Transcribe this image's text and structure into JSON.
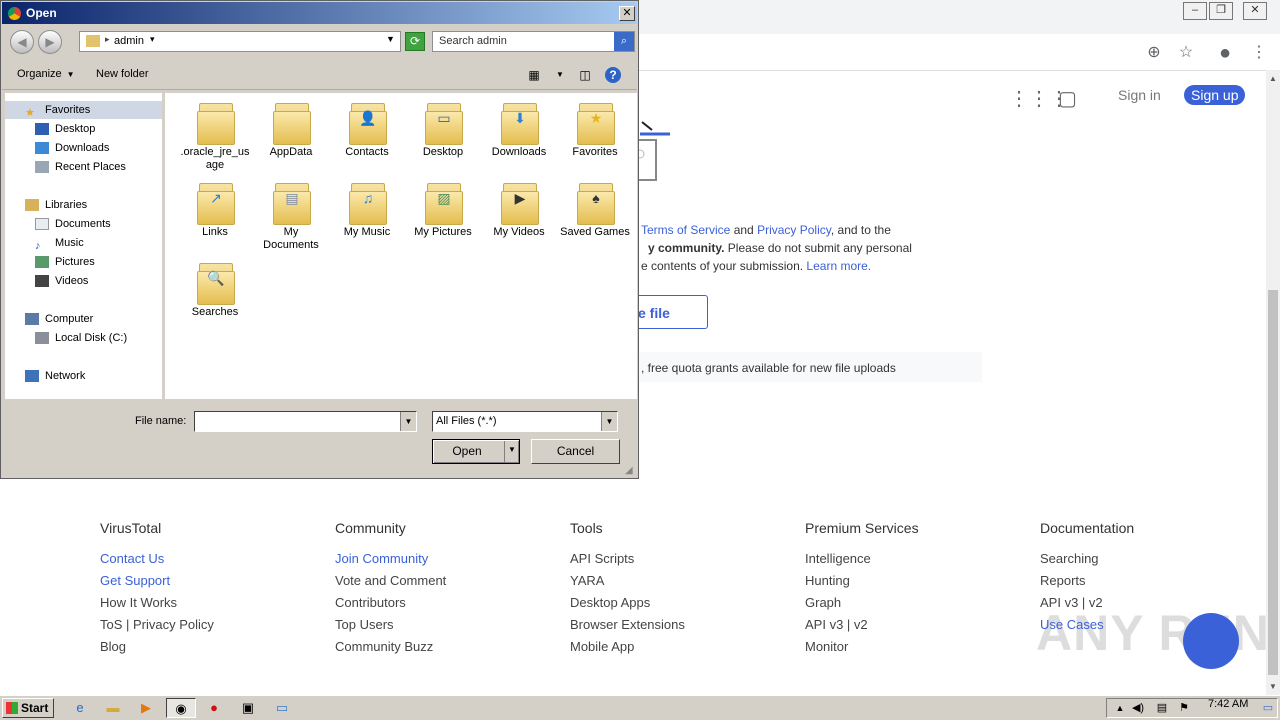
{
  "dialog": {
    "title": "Open",
    "address": "admin",
    "search_placeholder": "Search admin",
    "organize_label": "Organize",
    "new_folder_label": "New folder",
    "nav": {
      "favorites": "Favorites",
      "favorites_items": [
        "Desktop",
        "Downloads",
        "Recent Places"
      ],
      "libraries": "Libraries",
      "libraries_items": [
        "Documents",
        "Music",
        "Pictures",
        "Videos"
      ],
      "computer": "Computer",
      "computer_items": [
        "Local Disk (C:)"
      ],
      "network": "Network"
    },
    "files": [
      ".oracle_jre_usage",
      "AppData",
      "Contacts",
      "Desktop",
      "Downloads",
      "Favorites",
      "Links",
      "My Documents",
      "My Music",
      "My Pictures",
      "My Videos",
      "Saved Games",
      "Searches"
    ],
    "file_name_label": "File name:",
    "file_name_value": "",
    "file_type_value": "All Files (*.*)",
    "open_label": "Open",
    "cancel_label": "Cancel"
  },
  "browser": {
    "signin": "Sign in",
    "signup": "Sign up",
    "tos_line1_a": "Terms of Service",
    "tos_line1_b": " and ",
    "tos_line1_c": "Privacy Policy",
    "tos_line1_d": ", and to the",
    "tos_line2_a": "y community.",
    "tos_line2_b": " Please do not submit any personal",
    "tos_line3_a": "e contents of your submission. ",
    "tos_line3_b": "Learn more.",
    "upload_btn": "e file",
    "quota_text": ", free quota grants available for new file uploads",
    "footer": [
      {
        "heading": "VirusTotal",
        "links": [
          "Contact Us",
          "Get Support",
          "How It Works",
          "ToS | Privacy Policy",
          "Blog"
        ],
        "blue": [
          0,
          1
        ]
      },
      {
        "heading": "Community",
        "links": [
          "Join Community",
          "Vote and Comment",
          "Contributors",
          "Top Users",
          "Community Buzz"
        ],
        "blue": [
          0
        ]
      },
      {
        "heading": "Tools",
        "links": [
          "API Scripts",
          "YARA",
          "Desktop Apps",
          "Browser Extensions",
          "Mobile App"
        ],
        "blue": []
      },
      {
        "heading": "Premium Services",
        "links": [
          "Intelligence",
          "Hunting",
          "Graph",
          "API v3 | v2",
          "Monitor"
        ],
        "blue": []
      },
      {
        "heading": "Documentation",
        "links": [
          "Searching",
          "Reports",
          "API v3 | v2",
          "Use Cases"
        ],
        "blue": [
          3
        ]
      }
    ],
    "watermark": "ANY RUN"
  },
  "taskbar": {
    "start": "Start",
    "clock": "7:42 AM"
  }
}
